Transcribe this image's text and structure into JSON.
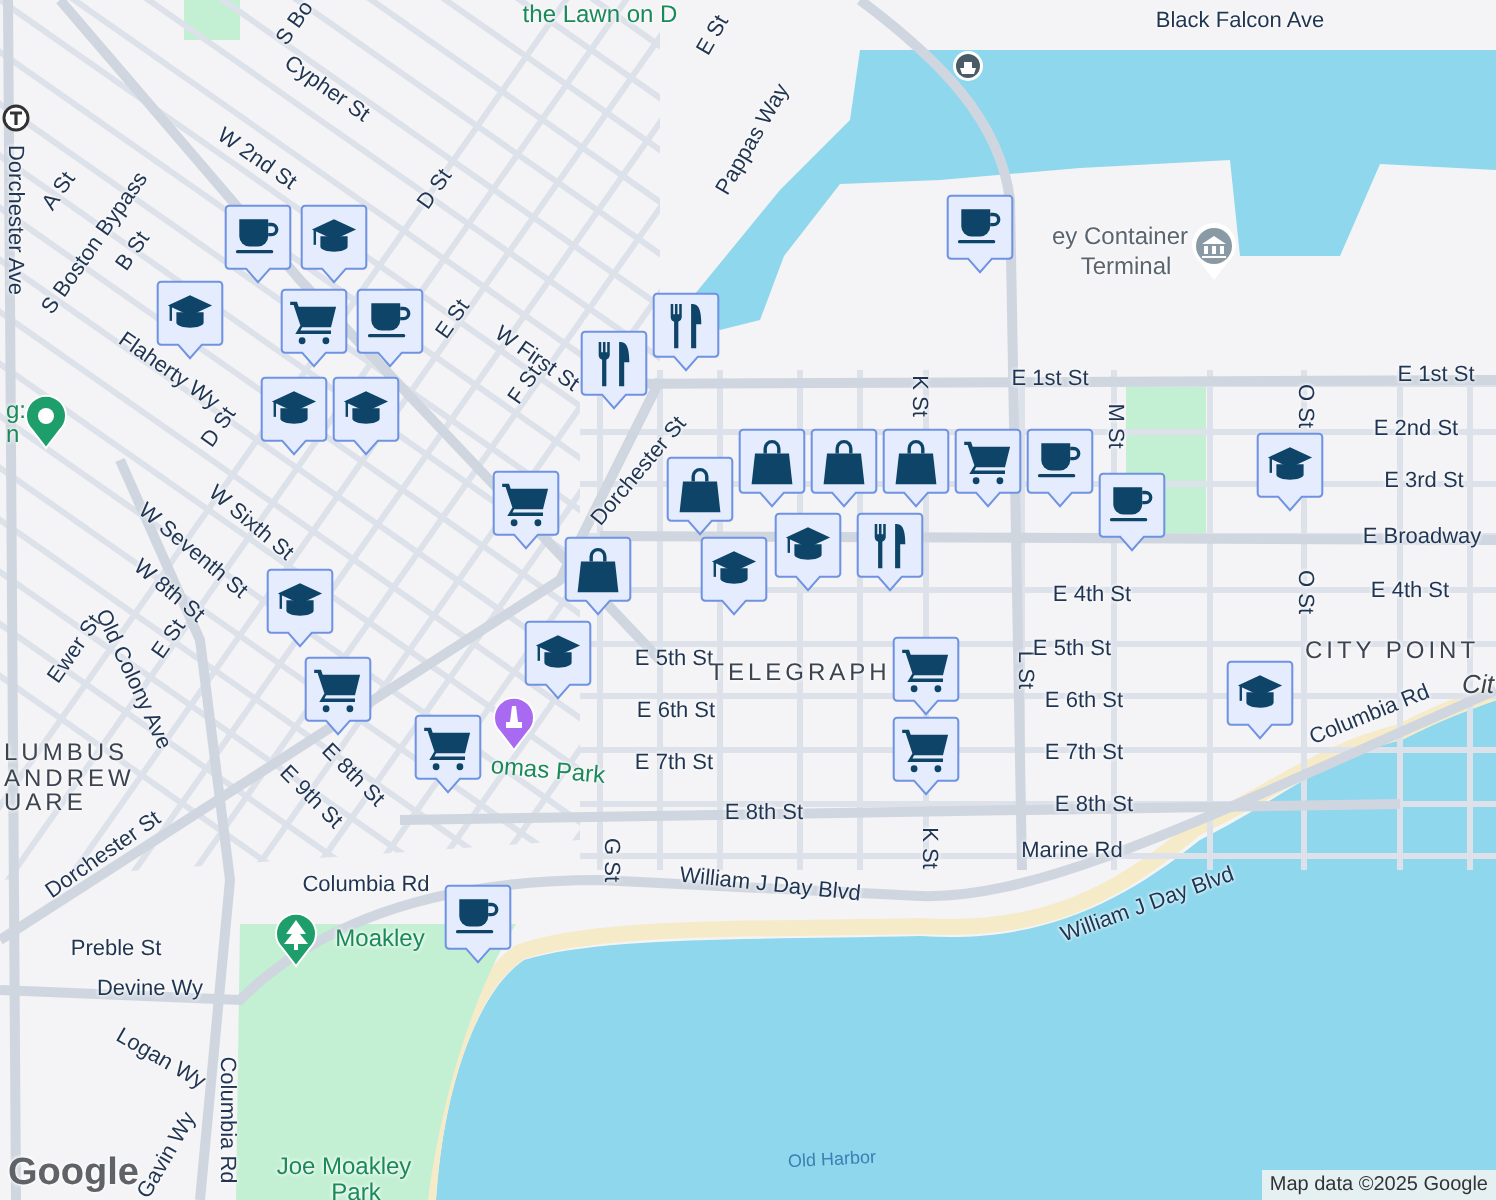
{
  "map": {
    "labels": [
      {
        "text": "the Lawn on D",
        "kind": "park"
      },
      {
        "text": "S Bo",
        "kind": "street"
      },
      {
        "text": "Cypher St",
        "kind": "street"
      },
      {
        "text": "E St",
        "kind": "street"
      },
      {
        "text": "Black Falcon Ave",
        "kind": "street"
      },
      {
        "text": "Pappas Way",
        "kind": "street"
      },
      {
        "text": "A St",
        "kind": "street"
      },
      {
        "text": "Dorchester Ave",
        "kind": "street"
      },
      {
        "text": "S Boston Bypass",
        "kind": "street"
      },
      {
        "text": "B St",
        "kind": "street"
      },
      {
        "text": "W 2nd St",
        "kind": "street"
      },
      {
        "text": "D St",
        "kind": "street"
      },
      {
        "text": "E St",
        "kind": "street"
      },
      {
        "text": "W First St",
        "kind": "street"
      },
      {
        "text": "F St",
        "kind": "street"
      },
      {
        "text": "ey Container",
        "kind": "poi"
      },
      {
        "text": "Terminal",
        "kind": "poi"
      },
      {
        "text": "Flaherty Wy",
        "kind": "street"
      },
      {
        "text": "D St",
        "kind": "street"
      },
      {
        "text": "g:",
        "kind": "park"
      },
      {
        "text": "n",
        "kind": "park"
      },
      {
        "text": "Dorchester St",
        "kind": "street"
      },
      {
        "text": "E 1st St",
        "kind": "street"
      },
      {
        "text": "E 1st St",
        "kind": "street"
      },
      {
        "text": "K St",
        "kind": "street"
      },
      {
        "text": "M St",
        "kind": "street"
      },
      {
        "text": "O St",
        "kind": "street"
      },
      {
        "text": "E 2nd St",
        "kind": "street"
      },
      {
        "text": "E 3rd St",
        "kind": "street"
      },
      {
        "text": "E Broadway",
        "kind": "street"
      },
      {
        "text": "W Sixth St",
        "kind": "street"
      },
      {
        "text": "W Seventh St",
        "kind": "street"
      },
      {
        "text": "W 8th St",
        "kind": "street"
      },
      {
        "text": "E 4th St",
        "kind": "street"
      },
      {
        "text": "O St",
        "kind": "street"
      },
      {
        "text": "E 4th St",
        "kind": "street"
      },
      {
        "text": "Ewer St",
        "kind": "street"
      },
      {
        "text": "E St",
        "kind": "street"
      },
      {
        "text": "Old Colony Ave",
        "kind": "street"
      },
      {
        "text": "E 5th St",
        "kind": "street"
      },
      {
        "text": "TELEGRAPH",
        "kind": "area"
      },
      {
        "text": "L St",
        "kind": "street"
      },
      {
        "text": "E 5th St",
        "kind": "street"
      },
      {
        "text": "CITY POINT",
        "kind": "area"
      },
      {
        "text": "Cit",
        "kind": "place"
      },
      {
        "text": "LUMBUS",
        "kind": "area"
      },
      {
        "text": "ANDREW",
        "kind": "area"
      },
      {
        "text": "UARE",
        "kind": "area"
      },
      {
        "text": "E 6th St",
        "kind": "street"
      },
      {
        "text": "E 6th St",
        "kind": "street"
      },
      {
        "text": "E 8th St",
        "kind": "street"
      },
      {
        "text": "omas Park",
        "kind": "park"
      },
      {
        "text": "E 7th St",
        "kind": "street"
      },
      {
        "text": "E 7th St",
        "kind": "street"
      },
      {
        "text": "Columbia Rd",
        "kind": "street"
      },
      {
        "text": "E 9th St",
        "kind": "street"
      },
      {
        "text": "E 8th St",
        "kind": "street"
      },
      {
        "text": "E 8th St",
        "kind": "street"
      },
      {
        "text": "Dorchester St",
        "kind": "street"
      },
      {
        "text": "K St",
        "kind": "street"
      },
      {
        "text": "Marine Rd",
        "kind": "street"
      },
      {
        "text": "G St",
        "kind": "street"
      },
      {
        "text": "Columbia Rd",
        "kind": "street"
      },
      {
        "text": "William J Day Blvd",
        "kind": "street"
      },
      {
        "text": "William J Day Blvd",
        "kind": "street"
      },
      {
        "text": "Moakley",
        "kind": "park"
      },
      {
        "text": "Preble St",
        "kind": "street"
      },
      {
        "text": "Devine Wy",
        "kind": "street"
      },
      {
        "text": "Logan Wy",
        "kind": "street"
      },
      {
        "text": "Columbia Rd",
        "kind": "street"
      },
      {
        "text": "Gavin Wy",
        "kind": "street"
      },
      {
        "text": "Joe Moakley",
        "kind": "park"
      },
      {
        "text": "Park",
        "kind": "park"
      },
      {
        "text": "Old Harbor",
        "kind": "water"
      }
    ],
    "markers": [
      {
        "kind": "coffee"
      },
      {
        "kind": "school"
      },
      {
        "kind": "school"
      },
      {
        "kind": "cart"
      },
      {
        "kind": "school"
      },
      {
        "kind": "school"
      },
      {
        "kind": "coffee"
      },
      {
        "kind": "food"
      },
      {
        "kind": "food"
      },
      {
        "kind": "coffee"
      },
      {
        "kind": "cart"
      },
      {
        "kind": "bag"
      },
      {
        "kind": "bag"
      },
      {
        "kind": "bag"
      },
      {
        "kind": "bag"
      },
      {
        "kind": "cart"
      },
      {
        "kind": "coffee"
      },
      {
        "kind": "school"
      },
      {
        "kind": "school"
      },
      {
        "kind": "food"
      },
      {
        "kind": "coffee"
      },
      {
        "kind": "school"
      },
      {
        "kind": "bag"
      },
      {
        "kind": "school"
      },
      {
        "kind": "school"
      },
      {
        "kind": "cart"
      },
      {
        "kind": "cart"
      },
      {
        "kind": "cart"
      },
      {
        "kind": "cart"
      },
      {
        "kind": "school"
      },
      {
        "kind": "coffee"
      }
    ],
    "logo": "Google",
    "attribution": "Map data ©2025 Google"
  }
}
